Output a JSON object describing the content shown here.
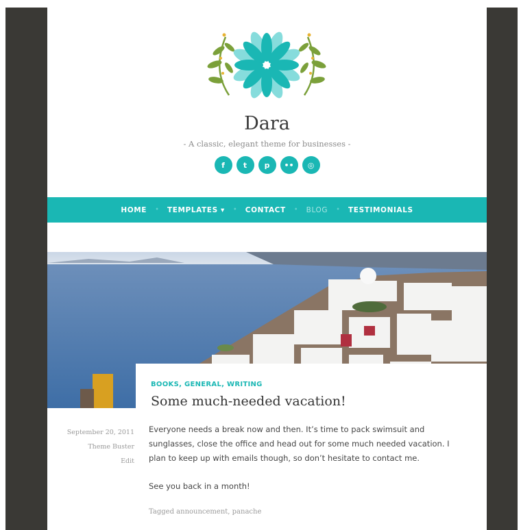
{
  "site": {
    "title": "Dara",
    "tagline": "- A classic, elegant theme for businesses -"
  },
  "social": [
    {
      "icon": "facebook-icon",
      "glyph": "f"
    },
    {
      "icon": "twitter-icon",
      "glyph": "t"
    },
    {
      "icon": "pinterest-icon",
      "glyph": "p"
    },
    {
      "icon": "flickr-icon",
      "glyph": "••"
    },
    {
      "icon": "instagram-icon",
      "glyph": "◎"
    }
  ],
  "nav": {
    "home": "HOME",
    "templates": "TEMPLATES ▾",
    "contact": "CONTACT",
    "blog": "BLOG",
    "testimonials": "TESTIMONIALS"
  },
  "post": {
    "cat1": "BOOKS",
    "cat2": "GENERAL",
    "cat3": "WRITING",
    "title": "Some much-needed vacation!",
    "date": "September 20, 2011",
    "author": "Theme Buster",
    "edit": "Edit",
    "para1": "Everyone needs a break now and then. It’s time to pack swimsuit and sunglasses, close the office and head out for some much needed vacation. I plan to keep up with emails though, so don’t hesitate to contact me.",
    "para2": "See you back in a month!",
    "tagged_prefix": "Tagged",
    "tag1": "announcement",
    "tag2": "panache"
  },
  "colors": {
    "accent": "#1ab7b4",
    "frame": "#3a3935"
  }
}
